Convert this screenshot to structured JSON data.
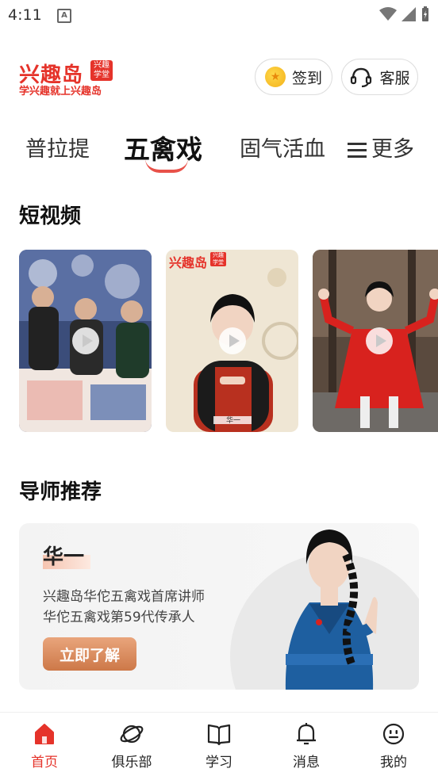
{
  "status_bar": {
    "time": "4:11",
    "a_icon": "A"
  },
  "header": {
    "logo_main": "兴趣岛",
    "logo_badge": "兴趣学堂",
    "logo_tagline": "学兴趣就上兴趣岛",
    "checkin_label": "签到",
    "service_label": "客服"
  },
  "tabs": [
    {
      "label": "普拉提",
      "active": false
    },
    {
      "label": "五禽戏",
      "active": true
    },
    {
      "label": "固气活血",
      "active": false
    },
    {
      "label": "更多",
      "active": false
    }
  ],
  "sections": {
    "short_video": "短视频",
    "mentor": "导师推荐"
  },
  "videos": [
    {
      "theme": "embroidery"
    },
    {
      "theme": "presenter",
      "overlay_brand": "兴趣岛",
      "overlay_badge": "兴趣学堂",
      "overlay_caption": "华一"
    },
    {
      "theme": "red-dress"
    }
  ],
  "mentor": {
    "name": "华一",
    "desc_line1": "兴趣岛华佗五禽戏首席讲师",
    "desc_line2": "华佗五禽戏第59代传承人",
    "cta": "立即了解"
  },
  "bottom_nav": [
    {
      "label": "首页",
      "icon": "home-icon",
      "active": true
    },
    {
      "label": "俱乐部",
      "icon": "planet-icon",
      "active": false
    },
    {
      "label": "学习",
      "icon": "book-icon",
      "active": false
    },
    {
      "label": "消息",
      "icon": "bell-icon",
      "active": false
    },
    {
      "label": "我的",
      "icon": "smiley-icon",
      "active": false
    }
  ],
  "colors": {
    "accent": "#e5332a",
    "cta": "#d98456"
  }
}
